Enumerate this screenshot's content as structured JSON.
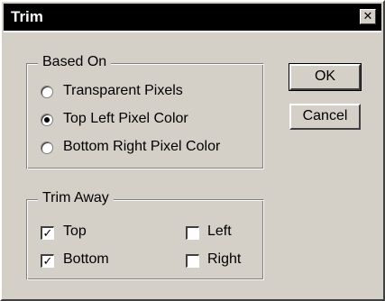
{
  "window": {
    "title": "Trim"
  },
  "based_on": {
    "label": "Based On",
    "options": [
      {
        "label": "Transparent Pixels",
        "selected": false
      },
      {
        "label": "Top Left Pixel Color",
        "selected": true
      },
      {
        "label": "Bottom Right Pixel Color",
        "selected": false
      }
    ]
  },
  "trim_away": {
    "label": "Trim Away",
    "top": {
      "label": "Top",
      "checked": true
    },
    "bottom": {
      "label": "Bottom",
      "checked": true
    },
    "left": {
      "label": "Left",
      "checked": false
    },
    "right": {
      "label": "Right",
      "checked": false
    }
  },
  "buttons": {
    "ok": "OK",
    "cancel": "Cancel"
  },
  "icons": {
    "close": "close-icon",
    "check": "checkmark-icon"
  },
  "colors": {
    "titlebar": "#000000",
    "face": "#d4d0c8"
  }
}
